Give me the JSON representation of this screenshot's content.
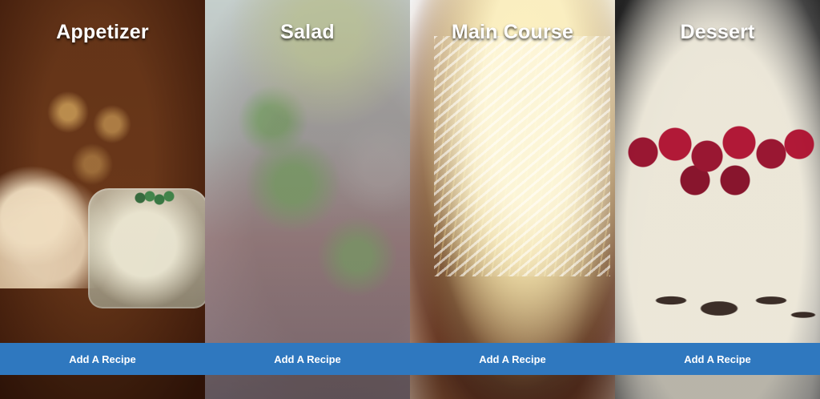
{
  "cards": [
    {
      "title": "Appetizer",
      "button_label": "Add A Recipe"
    },
    {
      "title": "Salad",
      "button_label": "Add A Recipe"
    },
    {
      "title": "Main Course",
      "button_label": "Add A Recipe"
    },
    {
      "title": "Dessert",
      "button_label": "Add A Recipe"
    }
  ],
  "colors": {
    "button_bg": "#2f78bf",
    "title_text": "#ffffff"
  }
}
